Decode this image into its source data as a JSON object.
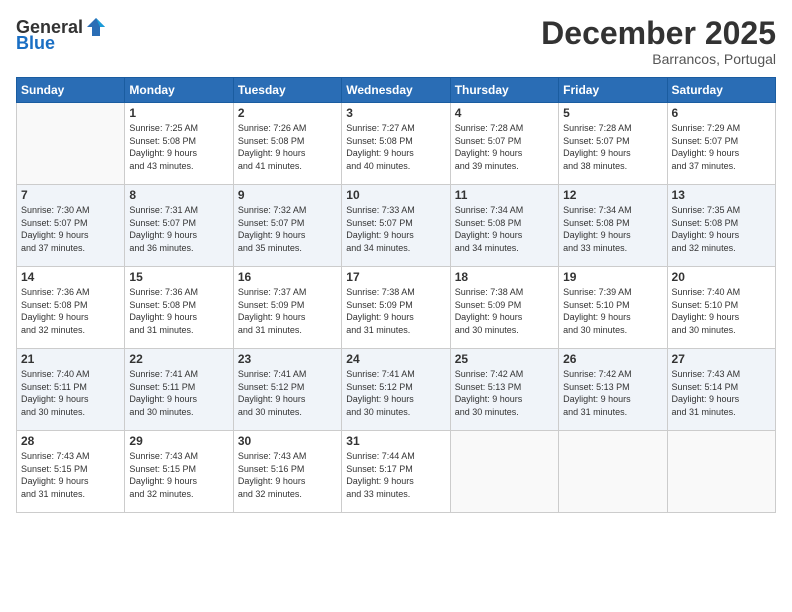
{
  "header": {
    "logo_general": "General",
    "logo_blue": "Blue",
    "month_title": "December 2025",
    "subtitle": "Barrancos, Portugal"
  },
  "calendar": {
    "days_of_week": [
      "Sunday",
      "Monday",
      "Tuesday",
      "Wednesday",
      "Thursday",
      "Friday",
      "Saturday"
    ],
    "weeks": [
      [
        {
          "day": "",
          "info": ""
        },
        {
          "day": "1",
          "info": "Sunrise: 7:25 AM\nSunset: 5:08 PM\nDaylight: 9 hours\nand 43 minutes."
        },
        {
          "day": "2",
          "info": "Sunrise: 7:26 AM\nSunset: 5:08 PM\nDaylight: 9 hours\nand 41 minutes."
        },
        {
          "day": "3",
          "info": "Sunrise: 7:27 AM\nSunset: 5:08 PM\nDaylight: 9 hours\nand 40 minutes."
        },
        {
          "day": "4",
          "info": "Sunrise: 7:28 AM\nSunset: 5:07 PM\nDaylight: 9 hours\nand 39 minutes."
        },
        {
          "day": "5",
          "info": "Sunrise: 7:28 AM\nSunset: 5:07 PM\nDaylight: 9 hours\nand 38 minutes."
        },
        {
          "day": "6",
          "info": "Sunrise: 7:29 AM\nSunset: 5:07 PM\nDaylight: 9 hours\nand 37 minutes."
        }
      ],
      [
        {
          "day": "7",
          "info": "Sunrise: 7:30 AM\nSunset: 5:07 PM\nDaylight: 9 hours\nand 37 minutes."
        },
        {
          "day": "8",
          "info": "Sunrise: 7:31 AM\nSunset: 5:07 PM\nDaylight: 9 hours\nand 36 minutes."
        },
        {
          "day": "9",
          "info": "Sunrise: 7:32 AM\nSunset: 5:07 PM\nDaylight: 9 hours\nand 35 minutes."
        },
        {
          "day": "10",
          "info": "Sunrise: 7:33 AM\nSunset: 5:07 PM\nDaylight: 9 hours\nand 34 minutes."
        },
        {
          "day": "11",
          "info": "Sunrise: 7:34 AM\nSunset: 5:08 PM\nDaylight: 9 hours\nand 34 minutes."
        },
        {
          "day": "12",
          "info": "Sunrise: 7:34 AM\nSunset: 5:08 PM\nDaylight: 9 hours\nand 33 minutes."
        },
        {
          "day": "13",
          "info": "Sunrise: 7:35 AM\nSunset: 5:08 PM\nDaylight: 9 hours\nand 32 minutes."
        }
      ],
      [
        {
          "day": "14",
          "info": "Sunrise: 7:36 AM\nSunset: 5:08 PM\nDaylight: 9 hours\nand 32 minutes."
        },
        {
          "day": "15",
          "info": "Sunrise: 7:36 AM\nSunset: 5:08 PM\nDaylight: 9 hours\nand 31 minutes."
        },
        {
          "day": "16",
          "info": "Sunrise: 7:37 AM\nSunset: 5:09 PM\nDaylight: 9 hours\nand 31 minutes."
        },
        {
          "day": "17",
          "info": "Sunrise: 7:38 AM\nSunset: 5:09 PM\nDaylight: 9 hours\nand 31 minutes."
        },
        {
          "day": "18",
          "info": "Sunrise: 7:38 AM\nSunset: 5:09 PM\nDaylight: 9 hours\nand 30 minutes."
        },
        {
          "day": "19",
          "info": "Sunrise: 7:39 AM\nSunset: 5:10 PM\nDaylight: 9 hours\nand 30 minutes."
        },
        {
          "day": "20",
          "info": "Sunrise: 7:40 AM\nSunset: 5:10 PM\nDaylight: 9 hours\nand 30 minutes."
        }
      ],
      [
        {
          "day": "21",
          "info": "Sunrise: 7:40 AM\nSunset: 5:11 PM\nDaylight: 9 hours\nand 30 minutes."
        },
        {
          "day": "22",
          "info": "Sunrise: 7:41 AM\nSunset: 5:11 PM\nDaylight: 9 hours\nand 30 minutes."
        },
        {
          "day": "23",
          "info": "Sunrise: 7:41 AM\nSunset: 5:12 PM\nDaylight: 9 hours\nand 30 minutes."
        },
        {
          "day": "24",
          "info": "Sunrise: 7:41 AM\nSunset: 5:12 PM\nDaylight: 9 hours\nand 30 minutes."
        },
        {
          "day": "25",
          "info": "Sunrise: 7:42 AM\nSunset: 5:13 PM\nDaylight: 9 hours\nand 30 minutes."
        },
        {
          "day": "26",
          "info": "Sunrise: 7:42 AM\nSunset: 5:13 PM\nDaylight: 9 hours\nand 31 minutes."
        },
        {
          "day": "27",
          "info": "Sunrise: 7:43 AM\nSunset: 5:14 PM\nDaylight: 9 hours\nand 31 minutes."
        }
      ],
      [
        {
          "day": "28",
          "info": "Sunrise: 7:43 AM\nSunset: 5:15 PM\nDaylight: 9 hours\nand 31 minutes."
        },
        {
          "day": "29",
          "info": "Sunrise: 7:43 AM\nSunset: 5:15 PM\nDaylight: 9 hours\nand 32 minutes."
        },
        {
          "day": "30",
          "info": "Sunrise: 7:43 AM\nSunset: 5:16 PM\nDaylight: 9 hours\nand 32 minutes."
        },
        {
          "day": "31",
          "info": "Sunrise: 7:44 AM\nSunset: 5:17 PM\nDaylight: 9 hours\nand 33 minutes."
        },
        {
          "day": "",
          "info": ""
        },
        {
          "day": "",
          "info": ""
        },
        {
          "day": "",
          "info": ""
        }
      ]
    ]
  }
}
